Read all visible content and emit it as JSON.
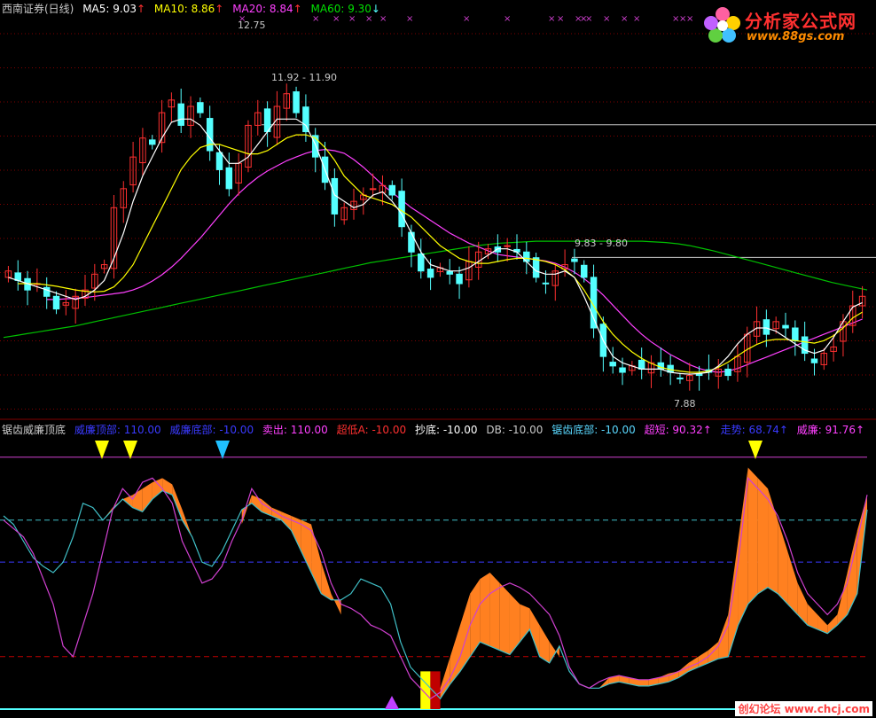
{
  "main_header": {
    "title": "西南证券(日线)",
    "ma5": "MA5: 9.03",
    "ma10": "MA10: 8.86",
    "ma20": "MA20: 8.84",
    "ma60": "MA60: 9.30",
    "arrow_up": "↑",
    "arrow_down": "↓"
  },
  "indicator_header": {
    "title": "锯齿威廉顶底",
    "items": [
      {
        "label": "威廉顶部: 110.00",
        "color": "#3a3aff"
      },
      {
        "label": "威廉底部: -10.00",
        "color": "#3a3aff"
      },
      {
        "label": "卖出: 110.00",
        "color": "#ff40ff"
      },
      {
        "label": "超低A: -10.00",
        "color": "#ff3030"
      },
      {
        "label": "抄底: -10.00",
        "color": "#ffffff"
      },
      {
        "label": "DB: -10.00",
        "color": "#c8c8c8"
      },
      {
        "label": "锯齿底部: -10.00",
        "color": "#5ad8ff"
      },
      {
        "label": "超短: 90.32↑",
        "color": "#ff40ff"
      },
      {
        "label": "走势: 68.74↑",
        "color": "#3a3aff"
      },
      {
        "label": "威廉: 91.76↑",
        "color": "#ff40ff"
      }
    ]
  },
  "logo": {
    "name": "分析家公式网",
    "url": "www.88gs.com"
  },
  "watermark": "创幻论坛 www.chcj.com",
  "price_annotations": {
    "high": "12.75",
    "resistance_1": "11.92 - 11.90",
    "resistance_2": "9.83 - 9.80",
    "low": "7.88"
  },
  "colors": {
    "up": "#ff3030",
    "down": "#54ffff",
    "ma5": "#ffffff",
    "ma10": "#ffff00",
    "ma20": "#ff40ff",
    "ma60": "#00c000",
    "grid": "#800000",
    "ind_cyan": "#40c0c8",
    "ind_magenta": "#d040d0",
    "fill_orange": "#ff8020",
    "fill_red": "#c00000",
    "fill_yellow": "#ffff00"
  },
  "chart_data": [
    {
      "type": "candlestick",
      "title": "西南证券(日线)",
      "ylim": [
        7.3,
        13.6
      ],
      "close": [
        9.6,
        9.45,
        9.3,
        9.4,
        9.2,
        9.0,
        9.1,
        9.2,
        9.3,
        9.55,
        9.7,
        10.6,
        10.9,
        11.4,
        11.7,
        11.6,
        12.1,
        12.3,
        11.9,
        12.2,
        12.1,
        11.5,
        11.2,
        10.9,
        11.3,
        11.9,
        12.1,
        11.8,
        12.2,
        12.4,
        12.1,
        11.8,
        11.4,
        11.0,
        10.5,
        10.6,
        10.7,
        10.8,
        10.9,
        10.95,
        10.8,
        10.3,
        9.9,
        9.6,
        9.5,
        9.65,
        9.55,
        9.4,
        9.75,
        9.9,
        9.95,
        9.9,
        10.0,
        9.9,
        9.75,
        9.5,
        9.4,
        9.6,
        9.7,
        9.75,
        9.5,
        8.7,
        8.25,
        8.1,
        8.0,
        8.1,
        8.05,
        8.15,
        8.05,
        8.0,
        7.9,
        7.95,
        7.95,
        8.0,
        8.05,
        7.95,
        8.25,
        8.6,
        8.8,
        8.6,
        8.8,
        8.7,
        8.5,
        8.3,
        8.15,
        8.3,
        8.4,
        8.8,
        9.05,
        9.2
      ],
      "ma5": [
        9.5,
        9.45,
        9.4,
        9.35,
        9.3,
        9.25,
        9.2,
        9.15,
        9.2,
        9.3,
        9.45,
        9.8,
        10.2,
        10.7,
        11.1,
        11.4,
        11.7,
        11.95,
        12.0,
        12.0,
        11.9,
        11.7,
        11.5,
        11.3,
        11.3,
        11.4,
        11.6,
        11.8,
        12.0,
        12.0,
        12.0,
        11.9,
        11.6,
        11.2,
        10.8,
        10.7,
        10.6,
        10.65,
        10.8,
        10.85,
        10.7,
        10.5,
        10.2,
        9.9,
        9.7,
        9.65,
        9.6,
        9.6,
        9.65,
        9.75,
        9.85,
        9.95,
        9.95,
        9.9,
        9.75,
        9.6,
        9.55,
        9.55,
        9.6,
        9.5,
        9.2,
        8.85,
        8.5,
        8.25,
        8.15,
        8.1,
        8.05,
        8.05,
        8.05,
        8.0,
        7.98,
        7.97,
        7.98,
        8.0,
        8.1,
        8.25,
        8.45,
        8.6,
        8.7,
        8.7,
        8.65,
        8.55,
        8.45,
        8.35,
        8.3,
        8.35,
        8.55,
        8.8,
        9.03,
        9.1
      ],
      "ma10": [
        9.4,
        9.4,
        9.4,
        9.38,
        9.36,
        9.33,
        9.3,
        9.28,
        9.27,
        9.28,
        9.35,
        9.5,
        9.7,
        10.0,
        10.3,
        10.6,
        10.9,
        11.2,
        11.4,
        11.55,
        11.6,
        11.6,
        11.55,
        11.5,
        11.45,
        11.45,
        11.5,
        11.6,
        11.7,
        11.75,
        11.75,
        11.7,
        11.55,
        11.35,
        11.1,
        10.95,
        10.8,
        10.75,
        10.7,
        10.65,
        10.55,
        10.45,
        10.3,
        10.15,
        10.0,
        9.9,
        9.8,
        9.75,
        9.72,
        9.72,
        9.75,
        9.78,
        9.8,
        9.8,
        9.78,
        9.75,
        9.7,
        9.62,
        9.5,
        9.3,
        9.05,
        8.8,
        8.6,
        8.45,
        8.32,
        8.22,
        8.14,
        8.08,
        8.04,
        8.02,
        8.0,
        8.0,
        8.02,
        8.08,
        8.16,
        8.26,
        8.36,
        8.44,
        8.5,
        8.52,
        8.52,
        8.5,
        8.48,
        8.46,
        8.5,
        8.58,
        8.7,
        8.86,
        8.95
      ],
      "ma20": [
        9.15,
        9.15,
        9.16,
        9.17,
        9.18,
        9.2,
        9.22,
        9.24,
        9.26,
        9.3,
        9.36,
        9.44,
        9.54,
        9.66,
        9.8,
        9.96,
        10.12,
        10.3,
        10.48,
        10.66,
        10.82,
        10.96,
        11.08,
        11.18,
        11.26,
        11.34,
        11.4,
        11.46,
        11.5,
        11.52,
        11.5,
        11.46,
        11.36,
        11.24,
        11.1,
        10.96,
        10.84,
        10.72,
        10.6,
        10.5,
        10.4,
        10.3,
        10.2,
        10.12,
        10.04,
        9.98,
        9.92,
        9.86,
        9.84,
        9.82,
        9.8,
        9.78,
        9.76,
        9.72,
        9.66,
        9.58,
        9.48,
        9.36,
        9.22,
        9.06,
        8.9,
        8.74,
        8.6,
        8.48,
        8.38,
        8.28,
        8.2,
        8.12,
        8.06,
        8.02,
        8.0,
        8.02,
        8.06,
        8.12,
        8.18,
        8.24,
        8.3,
        8.36,
        8.42,
        8.48,
        8.54,
        8.6,
        8.66,
        8.72,
        8.78,
        8.84
      ],
      "ma60": [
        8.55,
        8.58,
        8.61,
        8.64,
        8.67,
        8.7,
        8.73,
        8.77,
        8.81,
        8.85,
        8.89,
        8.93,
        8.97,
        9.01,
        9.05,
        9.09,
        9.13,
        9.17,
        9.21,
        9.25,
        9.29,
        9.33,
        9.37,
        9.41,
        9.45,
        9.49,
        9.53,
        9.57,
        9.61,
        9.65,
        9.69,
        9.73,
        9.76,
        9.79,
        9.82,
        9.85,
        9.88,
        9.91,
        9.94,
        9.97,
        10.0,
        10.02,
        10.04,
        10.05,
        10.06,
        10.07,
        10.07,
        10.07,
        10.07,
        10.07,
        10.07,
        10.07,
        10.07,
        10.07,
        10.07,
        10.06,
        10.05,
        10.03,
        10.0,
        9.96,
        9.92,
        9.87,
        9.82,
        9.77,
        9.72,
        9.67,
        9.62,
        9.57,
        9.52,
        9.47,
        9.42,
        9.38,
        9.34,
        9.3
      ]
    },
    {
      "type": "line",
      "title": "锯齿威廉顶底",
      "ylim": [
        -10,
        120
      ],
      "reference_lines": [
        110,
        80,
        60,
        15
      ],
      "series": [
        {
          "name": "威廉",
          "values": [
            80,
            76,
            72,
            64,
            52,
            40,
            20,
            15,
            30,
            45,
            65,
            85,
            95,
            90,
            98,
            100,
            95,
            88,
            70,
            60,
            50,
            52,
            58,
            70,
            80,
            95,
            88,
            85,
            82,
            80,
            78,
            75,
            65,
            50,
            40,
            38,
            35,
            30,
            28,
            25,
            15,
            5,
            0,
            -5,
            -2,
            5,
            15,
            30,
            40,
            45,
            48,
            50,
            48,
            45,
            40,
            35,
            25,
            10,
            2,
            0,
            3,
            5,
            6,
            5,
            4,
            4,
            5,
            6,
            8,
            10,
            12,
            15,
            20,
            30,
            60,
            100,
            95,
            90,
            82,
            70,
            55,
            45,
            40,
            35,
            40,
            50,
            70,
            92
          ]
        },
        {
          "name": "走势",
          "values": [
            82,
            78,
            70,
            62,
            58,
            55,
            60,
            72,
            88,
            86,
            80,
            85,
            90,
            86,
            84,
            90,
            94,
            92,
            80,
            72,
            60,
            58,
            65,
            75,
            85,
            88,
            84,
            82,
            80,
            75,
            65,
            55,
            45,
            42,
            42,
            45,
            52,
            50,
            48,
            40,
            22,
            10,
            5,
            0,
            -5,
            2,
            8,
            15,
            22,
            20,
            18,
            16,
            22,
            28,
            15,
            12,
            20,
            8,
            2,
            0,
            0,
            2,
            3,
            2,
            1,
            1,
            2,
            3,
            5,
            8,
            10,
            12,
            14,
            15,
            30,
            40,
            45,
            48,
            45,
            40,
            35,
            30,
            28,
            26,
            30,
            35,
            45,
            85
          ]
        },
        {
          "name": "超短",
          "values": [
            80,
            70,
            60,
            55,
            50,
            45,
            40,
            35,
            45,
            70,
            80,
            86,
            90,
            92,
            95,
            98,
            100,
            97,
            85,
            72,
            60,
            50,
            52,
            65,
            78,
            92,
            90,
            86,
            84,
            82,
            80,
            78,
            60,
            45,
            35,
            32,
            30,
            25,
            22,
            20,
            10,
            0,
            -8,
            -5,
            0,
            15,
            30,
            45,
            52,
            55,
            50,
            45,
            40,
            38,
            30,
            22,
            15,
            5,
            0,
            -5,
            0,
            5,
            6,
            5,
            4,
            4,
            5,
            7,
            8,
            12,
            15,
            18,
            22,
            35,
            70,
            105,
            100,
            95,
            80,
            65,
            50,
            40,
            35,
            30,
            35,
            55,
            75,
            92
          ]
        }
      ]
    }
  ]
}
